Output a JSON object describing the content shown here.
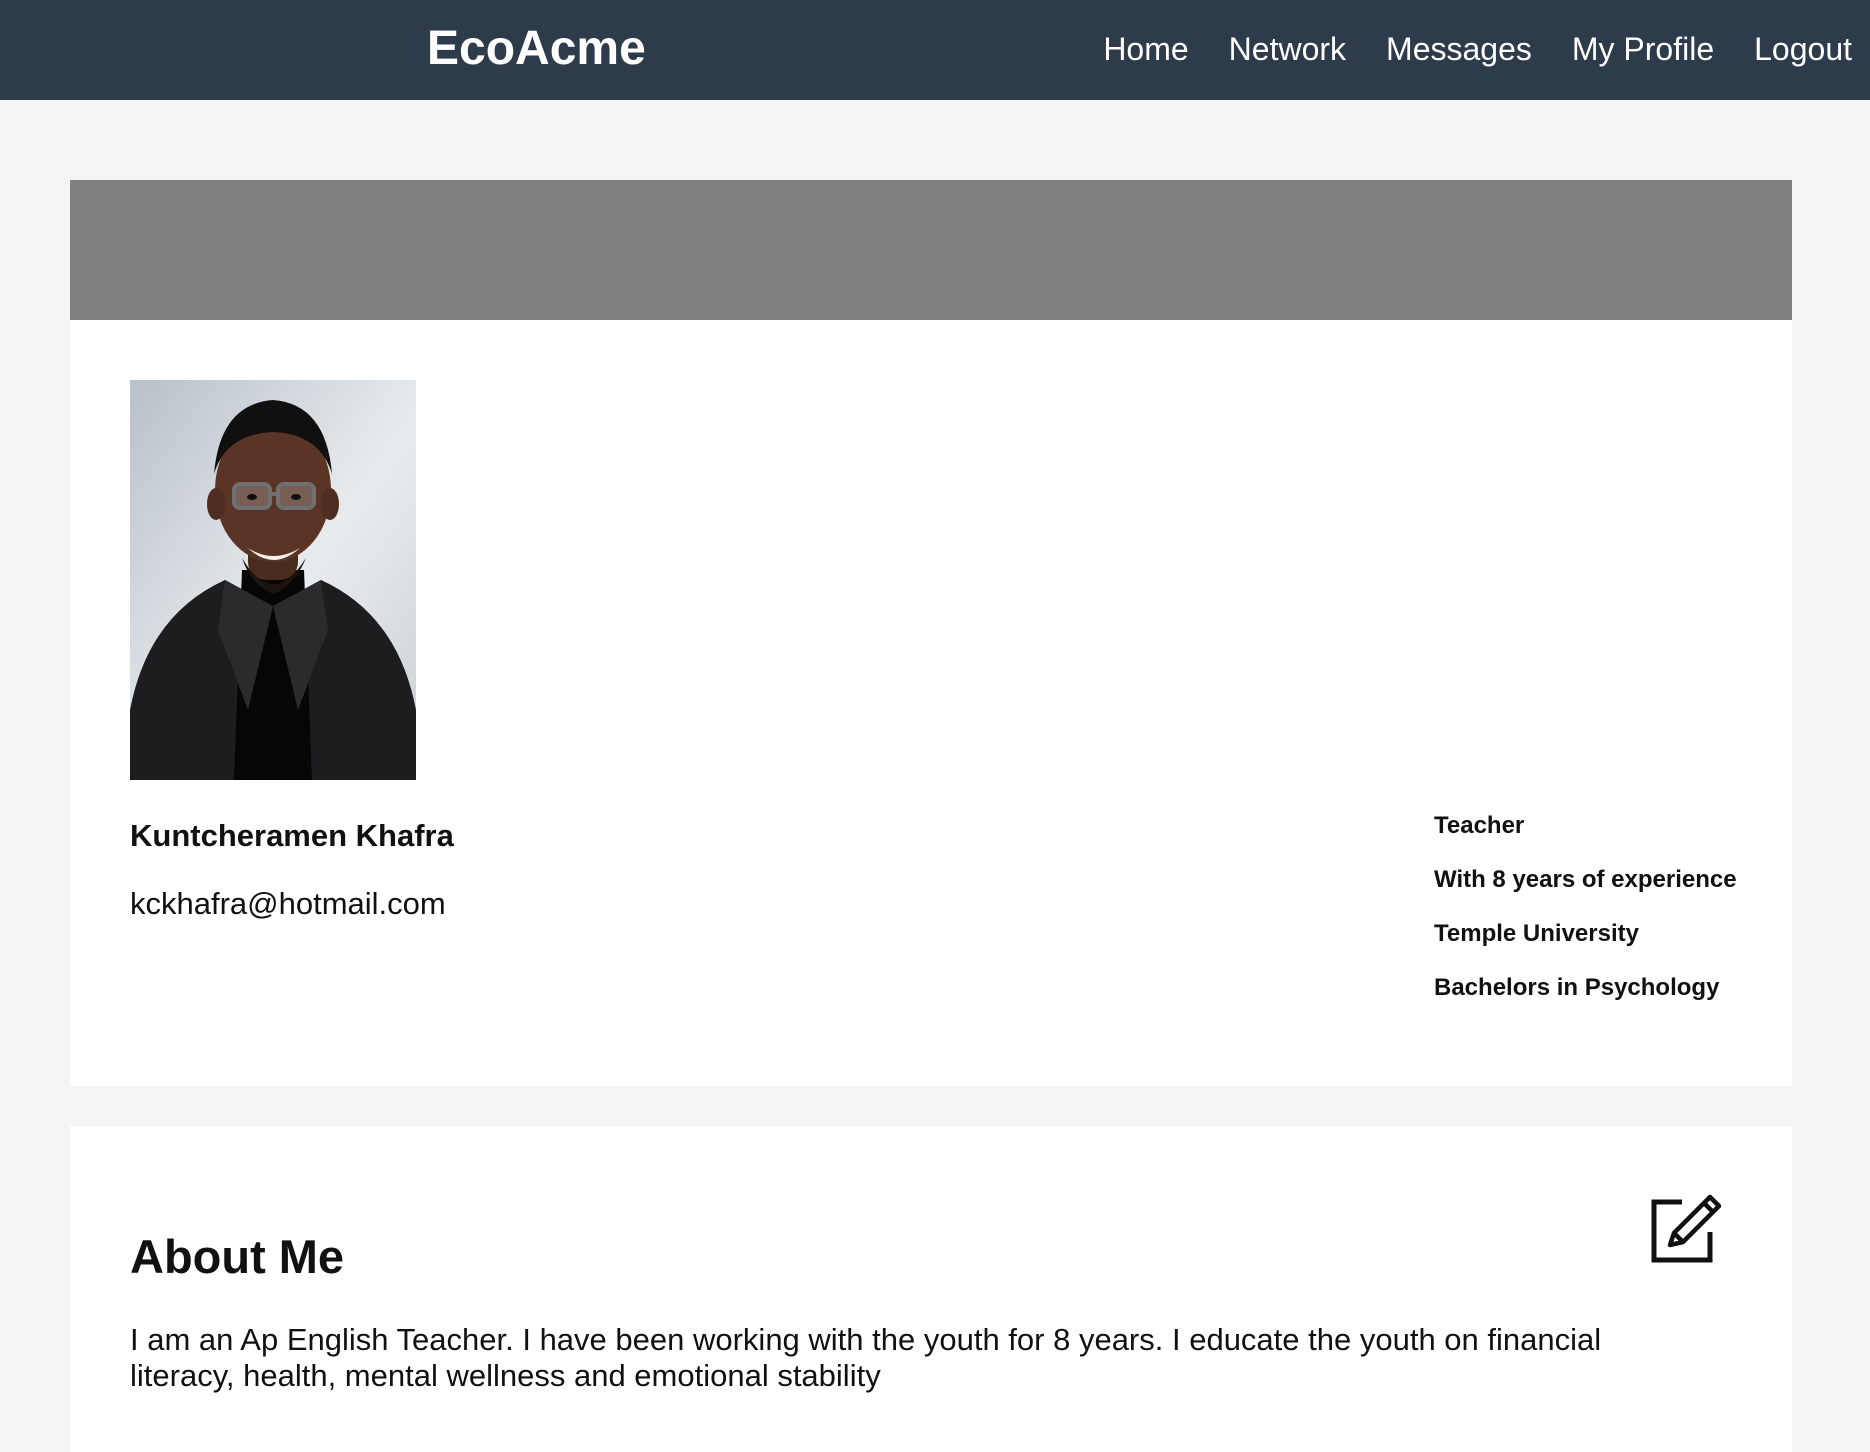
{
  "header": {
    "brand": "EcoAcme",
    "nav": [
      {
        "label": "Home"
      },
      {
        "label": "Network"
      },
      {
        "label": "Messages"
      },
      {
        "label": "My Profile"
      },
      {
        "label": "Logout"
      }
    ]
  },
  "profile": {
    "name": "Kuntcheramen Khafra",
    "email": "kckhafra@hotmail.com",
    "details": [
      "Teacher",
      "With 8 years of experience",
      "Temple University",
      "Bachelors in Psychology"
    ],
    "avatar_icon": "profile-photo"
  },
  "about": {
    "title": "About Me",
    "text": "I am an Ap English Teacher. I have been working with the youth for 8 years. I educate the youth on financial literacy, health, mental wellness and emotional stability",
    "edit_icon": "edit-icon"
  },
  "colors": {
    "navbar": "#2d3b4a",
    "banner": "#808080",
    "page_bg": "#f4f4f4",
    "card_bg": "#ffffff"
  }
}
